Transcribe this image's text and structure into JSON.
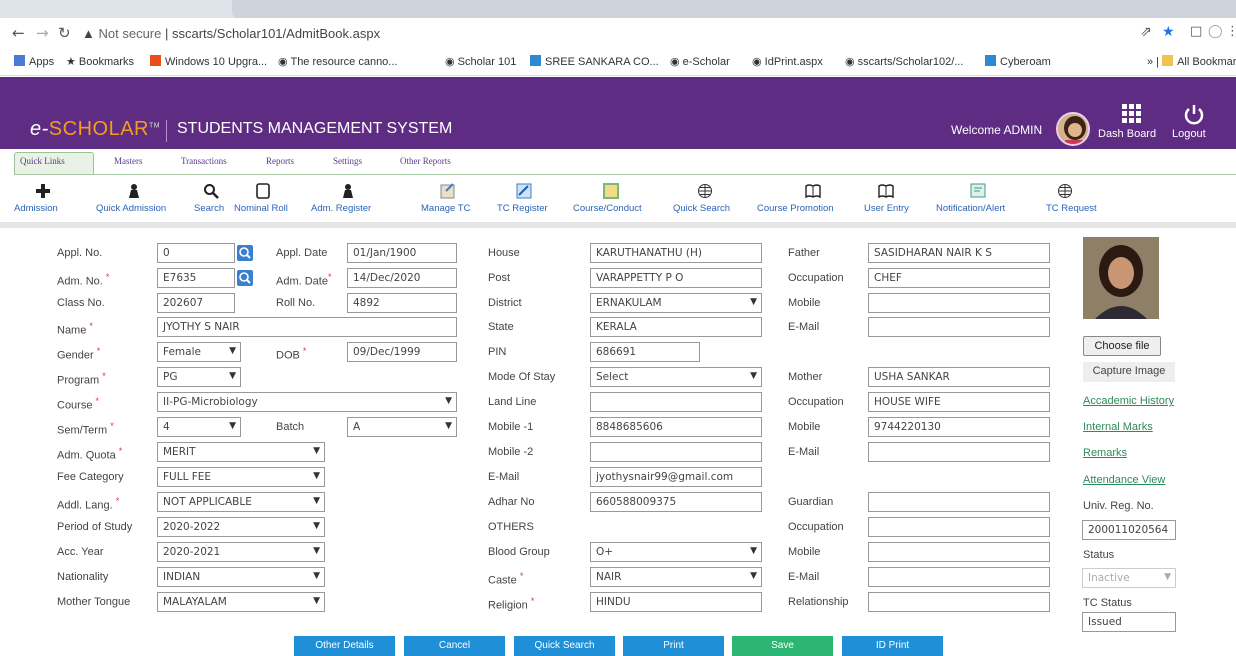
{
  "browser": {
    "url_prefix": "Not secure",
    "url": "sscarts/Scholar101/AdmitBook.aspx",
    "bookmarks": [
      "Apps",
      "Bookmarks",
      "Windows 10 Upgra...",
      "The resource canno...",
      "Scholar 101",
      "SREE SANKARA CO...",
      "e-Scholar",
      "IdPrint.aspx",
      "sscarts/Scholar102/...",
      "Cyberoam",
      "All Bookmarks"
    ]
  },
  "header": {
    "logo_e": "e-",
    "logo_scholar": "SCHOLAR",
    "logo_tm": "TM",
    "system_name": "STUDENTS MANAGEMENT SYSTEM",
    "welcome": "Welcome ADMIN",
    "dashboard": "Dash Board",
    "logout": "Logout"
  },
  "menu_tabs": [
    "Quick Links",
    "Masters",
    "Transactions",
    "Reports",
    "Settings",
    "Other Reports"
  ],
  "toolbar": [
    "Admission",
    "Quick Admission",
    "Search",
    "Nominal Roll",
    "Adm. Register",
    "Manage TC",
    "TC Register",
    "Course/Conduct",
    "Quick Search",
    "Course Promotion",
    "User Entry",
    "Notification/Alert",
    "TC Request"
  ],
  "form": {
    "appl_no": {
      "label": "Appl. No.",
      "value": "0"
    },
    "appl_date": {
      "label": "Appl. Date",
      "value": "01/Jan/1900"
    },
    "adm_no": {
      "label": "Adm. No.",
      "value": "E7635"
    },
    "adm_date": {
      "label": "Adm. Date",
      "value": "14/Dec/2020"
    },
    "class_no": {
      "label": "Class No.",
      "value": "202607"
    },
    "roll_no": {
      "label": "Roll No.",
      "value": "4892"
    },
    "name": {
      "label": "Name",
      "value": "JYOTHY S NAIR"
    },
    "gender": {
      "label": "Gender",
      "value": "Female"
    },
    "dob": {
      "label": "DOB",
      "value": "09/Dec/1999"
    },
    "program": {
      "label": "Program",
      "value": "PG"
    },
    "course": {
      "label": "Course",
      "value": "II-PG-Microbiology"
    },
    "sem_term": {
      "label": "Sem/Term",
      "value": "4"
    },
    "batch": {
      "label": "Batch",
      "value": "A"
    },
    "adm_quota": {
      "label": "Adm. Quota",
      "value": "MERIT"
    },
    "fee_category": {
      "label": "Fee Category",
      "value": "FULL FEE"
    },
    "addl_lang": {
      "label": "Addl. Lang.",
      "value": "NOT APPLICABLE"
    },
    "period_of_study": {
      "label": "Period of Study",
      "value": "2020-2022"
    },
    "acc_year": {
      "label": "Acc. Year",
      "value": "2020-2021"
    },
    "nationality": {
      "label": "Nationality",
      "value": "INDIAN"
    },
    "mother_tongue": {
      "label": "Mother Tongue",
      "value": "MALAYALAM"
    },
    "house": {
      "label": "House",
      "value": "KARUTHANATHU (H)"
    },
    "post": {
      "label": "Post",
      "value": "VARAPPETTY P O"
    },
    "district": {
      "label": "District",
      "value": "ERNAKULAM"
    },
    "state": {
      "label": "State",
      "value": "KERALA"
    },
    "pin": {
      "label": "PIN",
      "value": "686691"
    },
    "mode_of_stay": {
      "label": "Mode Of Stay",
      "value": "Select"
    },
    "land_line": {
      "label": "Land Line",
      "value": ""
    },
    "mobile1": {
      "label": "Mobile -1",
      "value": "8848685606"
    },
    "mobile2": {
      "label": "Mobile -2",
      "value": ""
    },
    "email": {
      "label": "E-Mail",
      "value": "jyothysnair99@gmail.com"
    },
    "adhar_no": {
      "label": "Adhar No",
      "value": "660588009375"
    },
    "others": {
      "label": "OTHERS"
    },
    "blood_group": {
      "label": "Blood Group",
      "value": "O+"
    },
    "caste": {
      "label": "Caste",
      "value": "NAIR"
    },
    "religion": {
      "label": "Religion",
      "value": "HINDU"
    },
    "father": {
      "label": "Father",
      "value": "SASIDHARAN NAIR K S"
    },
    "father_occupation": {
      "label": "Occupation",
      "value": "CHEF"
    },
    "father_mobile": {
      "label": "Mobile",
      "value": ""
    },
    "father_email": {
      "label": "E-Mail",
      "value": ""
    },
    "mother": {
      "label": "Mother",
      "value": "USHA SANKAR"
    },
    "mother_occupation": {
      "label": "Occupation",
      "value": "HOUSE WIFE"
    },
    "mother_mobile": {
      "label": "Mobile",
      "value": "9744220130"
    },
    "mother_email": {
      "label": "E-Mail",
      "value": ""
    },
    "guardian": {
      "label": "Guardian",
      "value": ""
    },
    "guardian_occupation": {
      "label": "Occupation",
      "value": ""
    },
    "guardian_mobile": {
      "label": "Mobile",
      "value": ""
    },
    "guardian_email": {
      "label": "E-Mail",
      "value": ""
    },
    "relationship": {
      "label": "Relationship",
      "value": ""
    }
  },
  "side": {
    "choose_file": "Choose file",
    "capture_image": "Capture Image",
    "academic_history": "Accademic History",
    "internal_marks": "Internal Marks",
    "remarks": "Remarks",
    "attendance_view": "Attendance View",
    "univ_reg_label": "Univ. Reg. No.",
    "univ_reg_value": "200011020564",
    "status_label": "Status",
    "status_value": "Inactive",
    "tc_status_label": "TC Status",
    "tc_status_value": "Issued"
  },
  "buttons": [
    "Other Details",
    "Cancel",
    "Quick Search",
    "Print",
    "Save",
    "ID Print"
  ],
  "colors": {
    "header": "#5e2c83",
    "accent": "#f59b1d",
    "button": "#1f8fd8",
    "save": "#2bb673"
  }
}
